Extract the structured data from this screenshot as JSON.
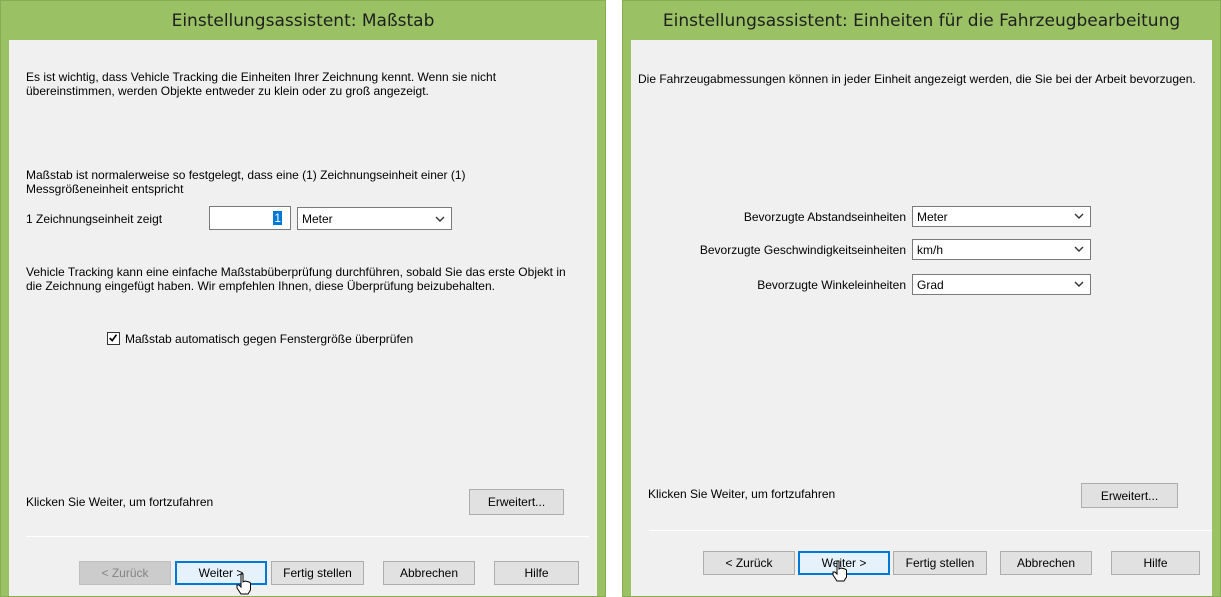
{
  "left": {
    "title": "Einstellungsassistent: Maßstab",
    "intro": "Es ist wichtig, dass Vehicle Tracking die Einheiten Ihrer Zeichnung kennt. Wenn sie nicht übereinstimmen, werden Objekte entweder zu klein oder zu groß angezeigt.",
    "scale_info": "Maßstab ist normalerweise so festgelegt, dass eine (1) Zeichnungseinheit einer (1) Messgrößeneinheit entspricht",
    "unit_label": "1 Zeichnungseinheit zeigt",
    "unit_value": "1",
    "unit_select": "Meter",
    "check_info": "Vehicle Tracking kann eine einfache Maßstabüberprüfung durchführen, sobald Sie das erste Objekt in die Zeichnung eingefügt haben. Wir empfehlen Ihnen, diese Überprüfung beizubehalten.",
    "checkbox_label": "Maßstab automatisch gegen Fenstergröße überprüfen",
    "checkbox_checked": true,
    "continue_text": "Klicken Sie Weiter, um fortzufahren",
    "advanced_button": "Erweitert...",
    "buttons": {
      "back": "< Zurück",
      "next": "Weiter >",
      "finish": "Fertig stellen",
      "cancel": "Abbrechen",
      "help": "Hilfe"
    }
  },
  "right": {
    "title": "Einstellungsassistent: Einheiten für die Fahrzeugbearbeitung",
    "intro": "Die Fahrzeugabmessungen können in jeder Einheit angezeigt werden, die Sie bei der Arbeit bevorzugen.",
    "fields": [
      {
        "label": "Bevorzugte Abstandseinheiten",
        "value": "Meter"
      },
      {
        "label": "Bevorzugte Geschwindigkeitseinheiten",
        "value": "km/h"
      },
      {
        "label": "Bevorzugte Winkeleinheiten",
        "value": "Grad"
      }
    ],
    "continue_text": "Klicken Sie Weiter, um fortzufahren",
    "advanced_button": "Erweitert...",
    "buttons": {
      "back": "< Zurück",
      "next": "Weiter >",
      "finish": "Fertig stellen",
      "cancel": "Abbrechen",
      "help": "Hilfe"
    }
  },
  "icons": [
    "chevron-down-icon",
    "checkmark-icon",
    "mouse-pointer-icon"
  ],
  "colors": {
    "titlebar": "#9ac264",
    "client": "#f0f0f0",
    "default_button_border": "#0078d7"
  }
}
